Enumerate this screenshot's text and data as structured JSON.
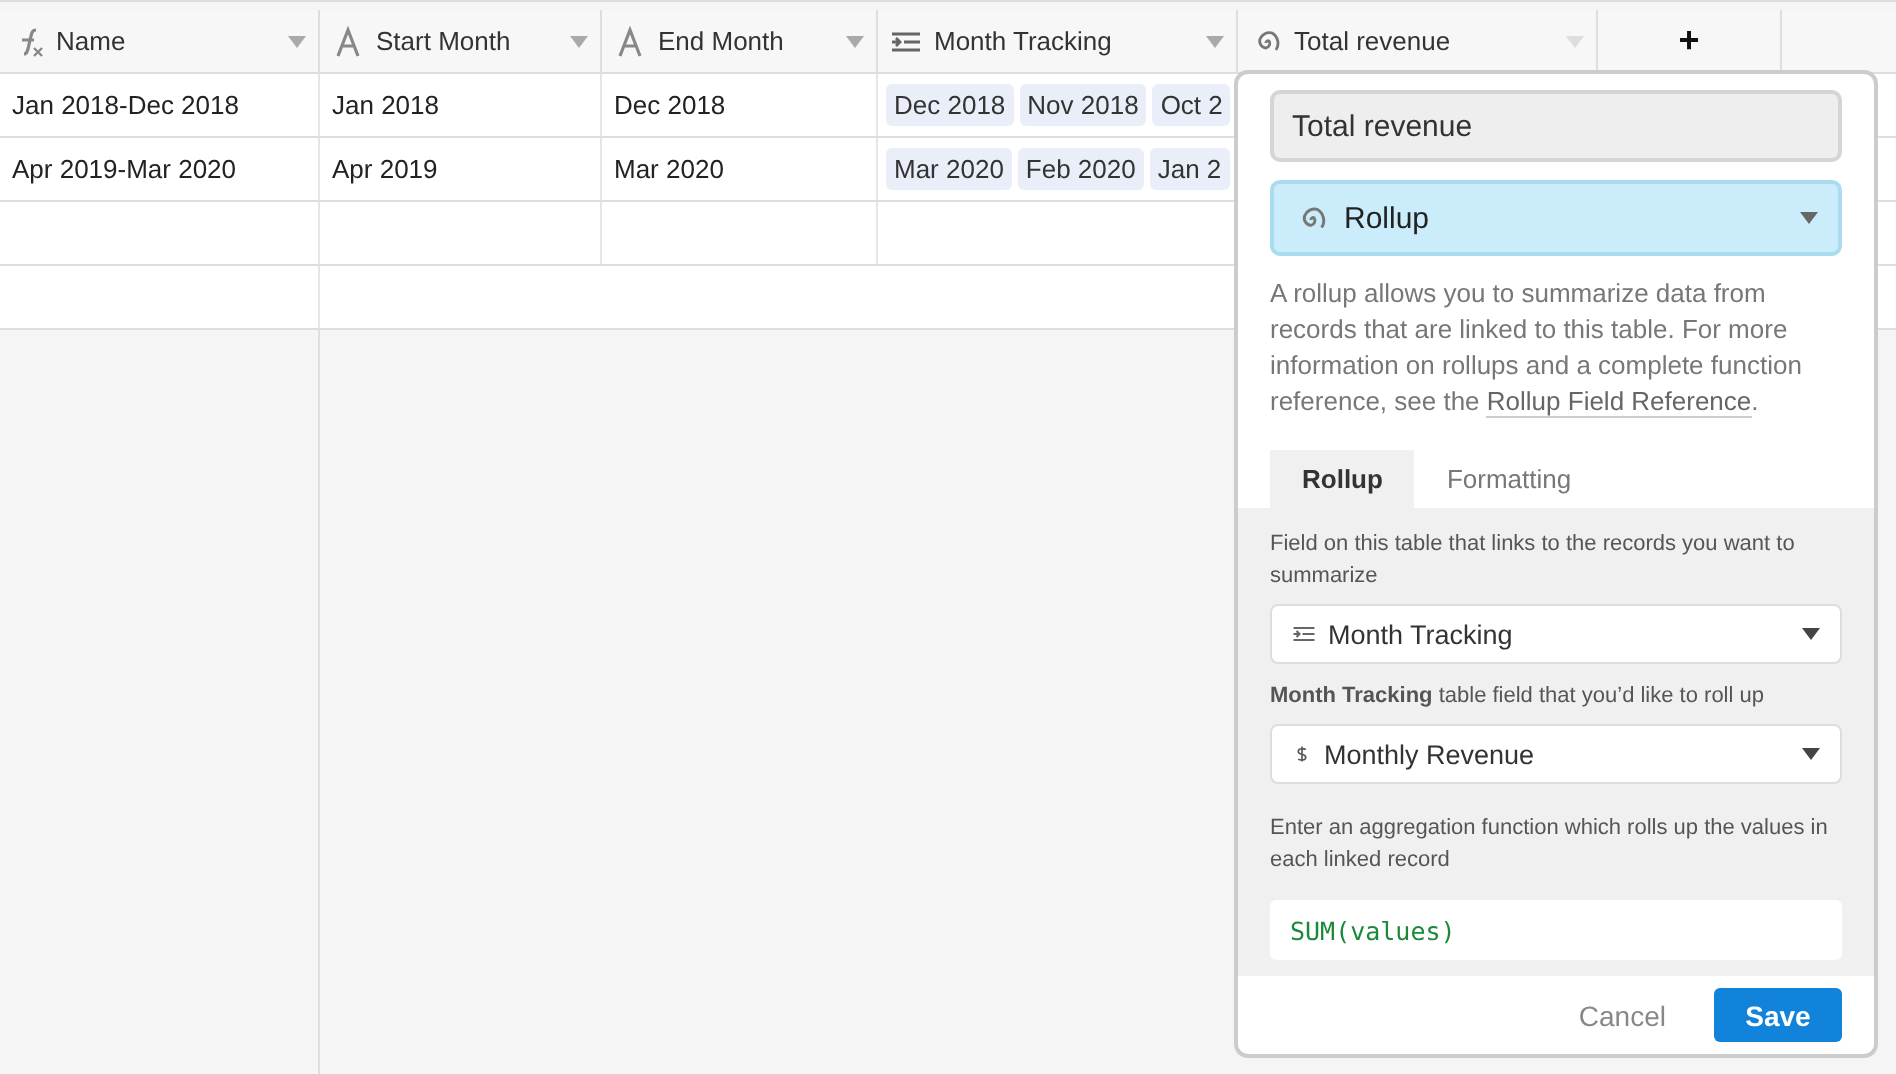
{
  "columns": [
    {
      "kind": "formula",
      "label": "Name"
    },
    {
      "kind": "text",
      "label": "Start Month"
    },
    {
      "kind": "text",
      "label": "End Month"
    },
    {
      "kind": "link",
      "label": "Month Tracking"
    },
    {
      "kind": "rollup",
      "label": "Total revenue"
    }
  ],
  "add_column": "+",
  "rows": [
    {
      "name": "Jan 2018-Dec 2018",
      "start": "Jan 2018",
      "end": "Dec 2018",
      "tracking": [
        "Dec 2018",
        "Nov 2018",
        "Oct 2"
      ]
    },
    {
      "name": "Apr 2019-Mar 2020",
      "start": "Apr 2019",
      "end": "Mar 2020",
      "tracking": [
        "Mar 2020",
        "Feb 2020",
        "Jan 2"
      ]
    }
  ],
  "editor": {
    "name_value": "Total revenue",
    "field_type": {
      "kind": "rollup",
      "label": "Rollup"
    },
    "description": "A rollup allows you to summarize data from records that are linked to this table. For more information on rollups and a complete function reference, see the ",
    "description_link": "Rollup Field Reference",
    "description_end": ".",
    "tabs": [
      {
        "label": "Rollup",
        "selected": true
      },
      {
        "label": "Formatting",
        "selected": false
      }
    ],
    "link_field_label": "Field on this table that links to the records you want to summarize",
    "link_field": {
      "kind": "link",
      "label": "Month Tracking"
    },
    "rollup_field_label": "**Month Tracking** table field that you’d like to roll up",
    "rollup_field": {
      "kind": "currency",
      "label": "Monthly Revenue"
    },
    "function_label": "Enter an aggregation function which rolls up the values in each linked record",
    "function_value": "SUM(values)",
    "buttons": {
      "cancel": "Cancel",
      "save": "Save"
    }
  }
}
